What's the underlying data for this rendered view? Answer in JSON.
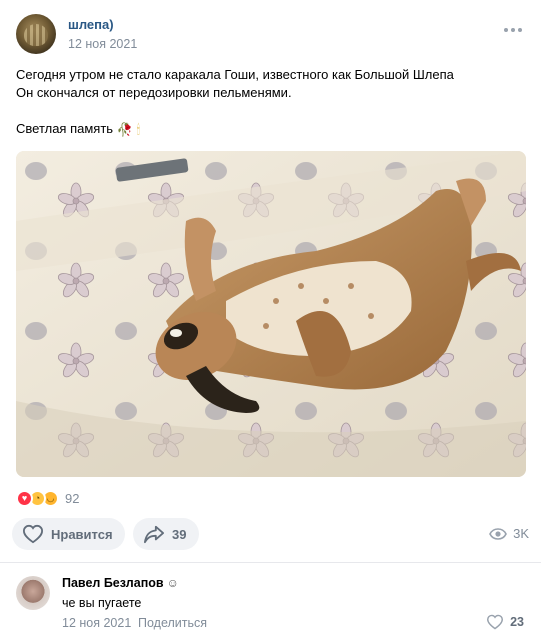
{
  "post": {
    "author": "шлепа)",
    "date": "12 ноя 2021",
    "text_lines": [
      "Сегодня утром не стало каракала Гоши, известного как Большой Шлепа",
      "Он скончался от передозировки пельменями.",
      "",
      "Светлая память"
    ],
    "text_emoji": [
      "rose-emoji",
      "candle-emoji"
    ],
    "image_alt_subject": "caracal lying on its back on a mattress",
    "reactions": {
      "icons": [
        "heart",
        "sad",
        "laugh"
      ],
      "count": "92"
    },
    "like_label": "Нравится",
    "share_count": "39",
    "views": "3K"
  },
  "comment": {
    "author": "Павел Безлапов",
    "text": "че вы пугаете",
    "date": "12 ноя 2021",
    "share_label": "Поделиться",
    "like_count": "23"
  },
  "colors": {
    "link": "#2a5885",
    "muted": "#818c99",
    "button_bg": "#f0f2f5",
    "heart": "#ff3347"
  }
}
